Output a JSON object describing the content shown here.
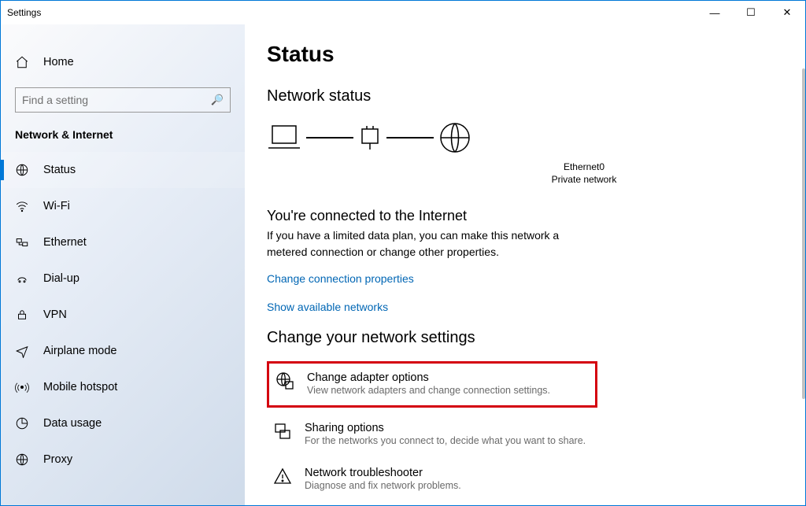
{
  "window": {
    "title": "Settings"
  },
  "titlebar": {
    "minimize": "—",
    "maximize": "☐",
    "close": "✕"
  },
  "sidebar": {
    "home": "Home",
    "search_placeholder": "Find a setting",
    "section": "Network & Internet",
    "items": [
      {
        "label": "Status",
        "icon": "status-icon",
        "active": true
      },
      {
        "label": "Wi-Fi",
        "icon": "wifi-icon",
        "active": false
      },
      {
        "label": "Ethernet",
        "icon": "ethernet-icon",
        "active": false
      },
      {
        "label": "Dial-up",
        "icon": "dialup-icon",
        "active": false
      },
      {
        "label": "VPN",
        "icon": "vpn-icon",
        "active": false
      },
      {
        "label": "Airplane mode",
        "icon": "airplane-icon",
        "active": false
      },
      {
        "label": "Mobile hotspot",
        "icon": "hotspot-icon",
        "active": false
      },
      {
        "label": "Data usage",
        "icon": "data-usage-icon",
        "active": false
      },
      {
        "label": "Proxy",
        "icon": "proxy-icon",
        "active": false
      }
    ]
  },
  "content": {
    "page_title": "Status",
    "status_heading": "Network status",
    "diagram": {
      "connection": "Ethernet0",
      "network_type": "Private network"
    },
    "connected": {
      "title": "You're connected to the Internet",
      "desc": "If you have a limited data plan, you can make this network a metered connection or change other properties."
    },
    "links": {
      "change_properties": "Change connection properties",
      "show_networks": "Show available networks"
    },
    "section_heading": "Change your network settings",
    "settings": [
      {
        "title": "Change adapter options",
        "desc": "View network adapters and change connection settings.",
        "icon": "globe-adapter-icon",
        "highlighted": true
      },
      {
        "title": "Sharing options",
        "desc": "For the networks you connect to, decide what you want to share.",
        "icon": "sharing-icon",
        "highlighted": false
      },
      {
        "title": "Network troubleshooter",
        "desc": "Diagnose and fix network problems.",
        "icon": "troubleshoot-icon",
        "highlighted": false
      }
    ]
  }
}
